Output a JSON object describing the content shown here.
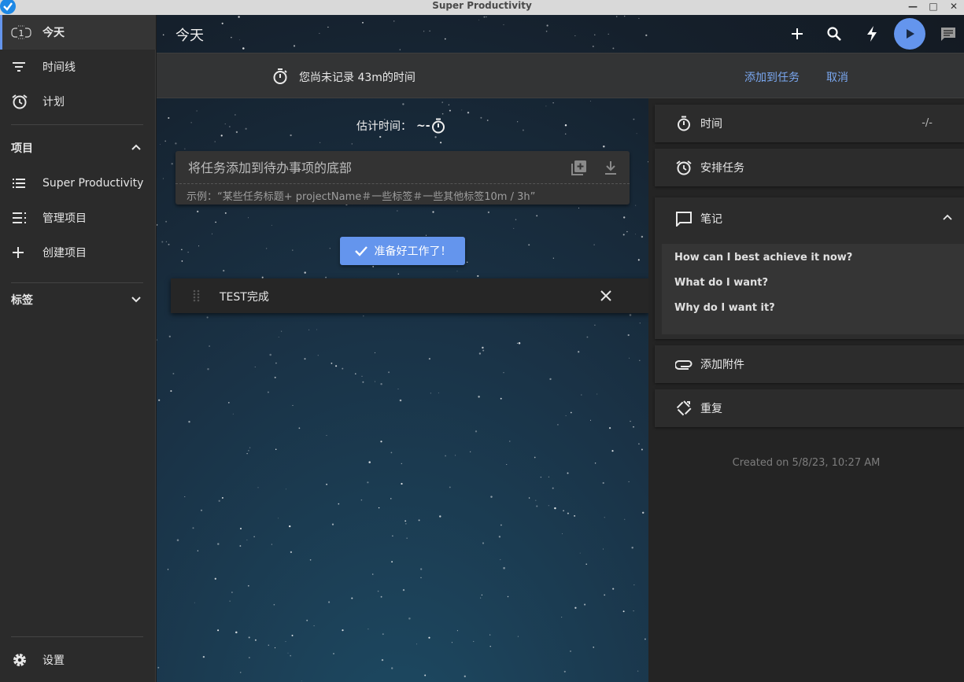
{
  "window": {
    "title": "Super Productivity"
  },
  "sidebar": {
    "nav": [
      {
        "label": "今天",
        "icon": "today-icon"
      },
      {
        "label": "时间线",
        "icon": "timeline-icon"
      },
      {
        "label": "计划",
        "icon": "alarm-icon"
      }
    ],
    "projects_header": "项目",
    "projects": [
      {
        "label": "Super Productivity",
        "icon": "list-icon"
      },
      {
        "label": "管理项目",
        "icon": "manage-list-icon"
      },
      {
        "label": "创建项目",
        "icon": "plus-icon"
      }
    ],
    "tags_header": "标签",
    "settings_label": "设置"
  },
  "topbar": {
    "title": "今天"
  },
  "banner": {
    "text": "您尚未记录 43m的时间",
    "add_to_task": "添加到任务",
    "cancel": "取消"
  },
  "estimate": {
    "label": "估计时间：",
    "value": "~-"
  },
  "add_task": {
    "placeholder": "将任务添加到待办事项的底部",
    "hint": "示例：“某些任务标题+ projectName＃一些标签＃一些其他标签10m / 3h”"
  },
  "ready_button": "准备好工作了！",
  "task": {
    "title": "TEST完成"
  },
  "detail": {
    "time_label": "时间",
    "time_value": "-/-",
    "schedule_label": "安排任务",
    "notes_label": "笔记",
    "notes_lines": [
      "How can I best achieve it now?",
      "What do I want?",
      "Why do I want it?"
    ],
    "attachment_label": "添加附件",
    "repeat_label": "重复",
    "created": "Created on 5/8/23, 10:27 AM"
  },
  "colors": {
    "accent": "#6495ed",
    "sidebar_bg": "#2b2b2b",
    "panel_bg": "#242424"
  }
}
